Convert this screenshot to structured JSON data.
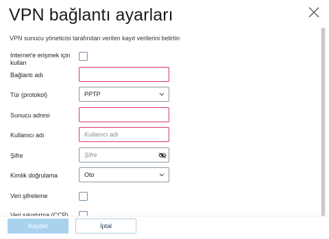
{
  "dialog": {
    "title": "VPN bağlantı ayarları",
    "subtitle": "VPN sunucu yöneticisi tarafından verilen kayıt verilerini belirtin"
  },
  "fields": {
    "internet_label": "Internet'e erişmek için kullan",
    "connection_name_label": "Bağlantı adı",
    "connection_name_value": "",
    "protocol_label": "Tür (protokol)",
    "protocol_value": "PPTP",
    "server_label": "Sunucu adresi",
    "server_value": "",
    "username_label": "Kullanıcı adı",
    "username_placeholder": "Kullanıcı adı",
    "password_label": "Şifre",
    "password_placeholder": "Şifre",
    "auth_label": "Kimlik doğrulama",
    "auth_value": "Oto",
    "encryption_label": "Veri şifreleme",
    "compression_label": "Veri sıkıştırma (CCP)"
  },
  "buttons": {
    "save_label": "Kaydet",
    "cancel_label": "İptal"
  },
  "colors": {
    "invalid_border": "#d9346a",
    "checkbox_border": "#6a8fb0",
    "save_disabled_bg": "#a9d2ef"
  },
  "icons": {
    "close": "close-icon",
    "chevron": "chevron-down-icon",
    "eye": "eye-off-icon"
  }
}
